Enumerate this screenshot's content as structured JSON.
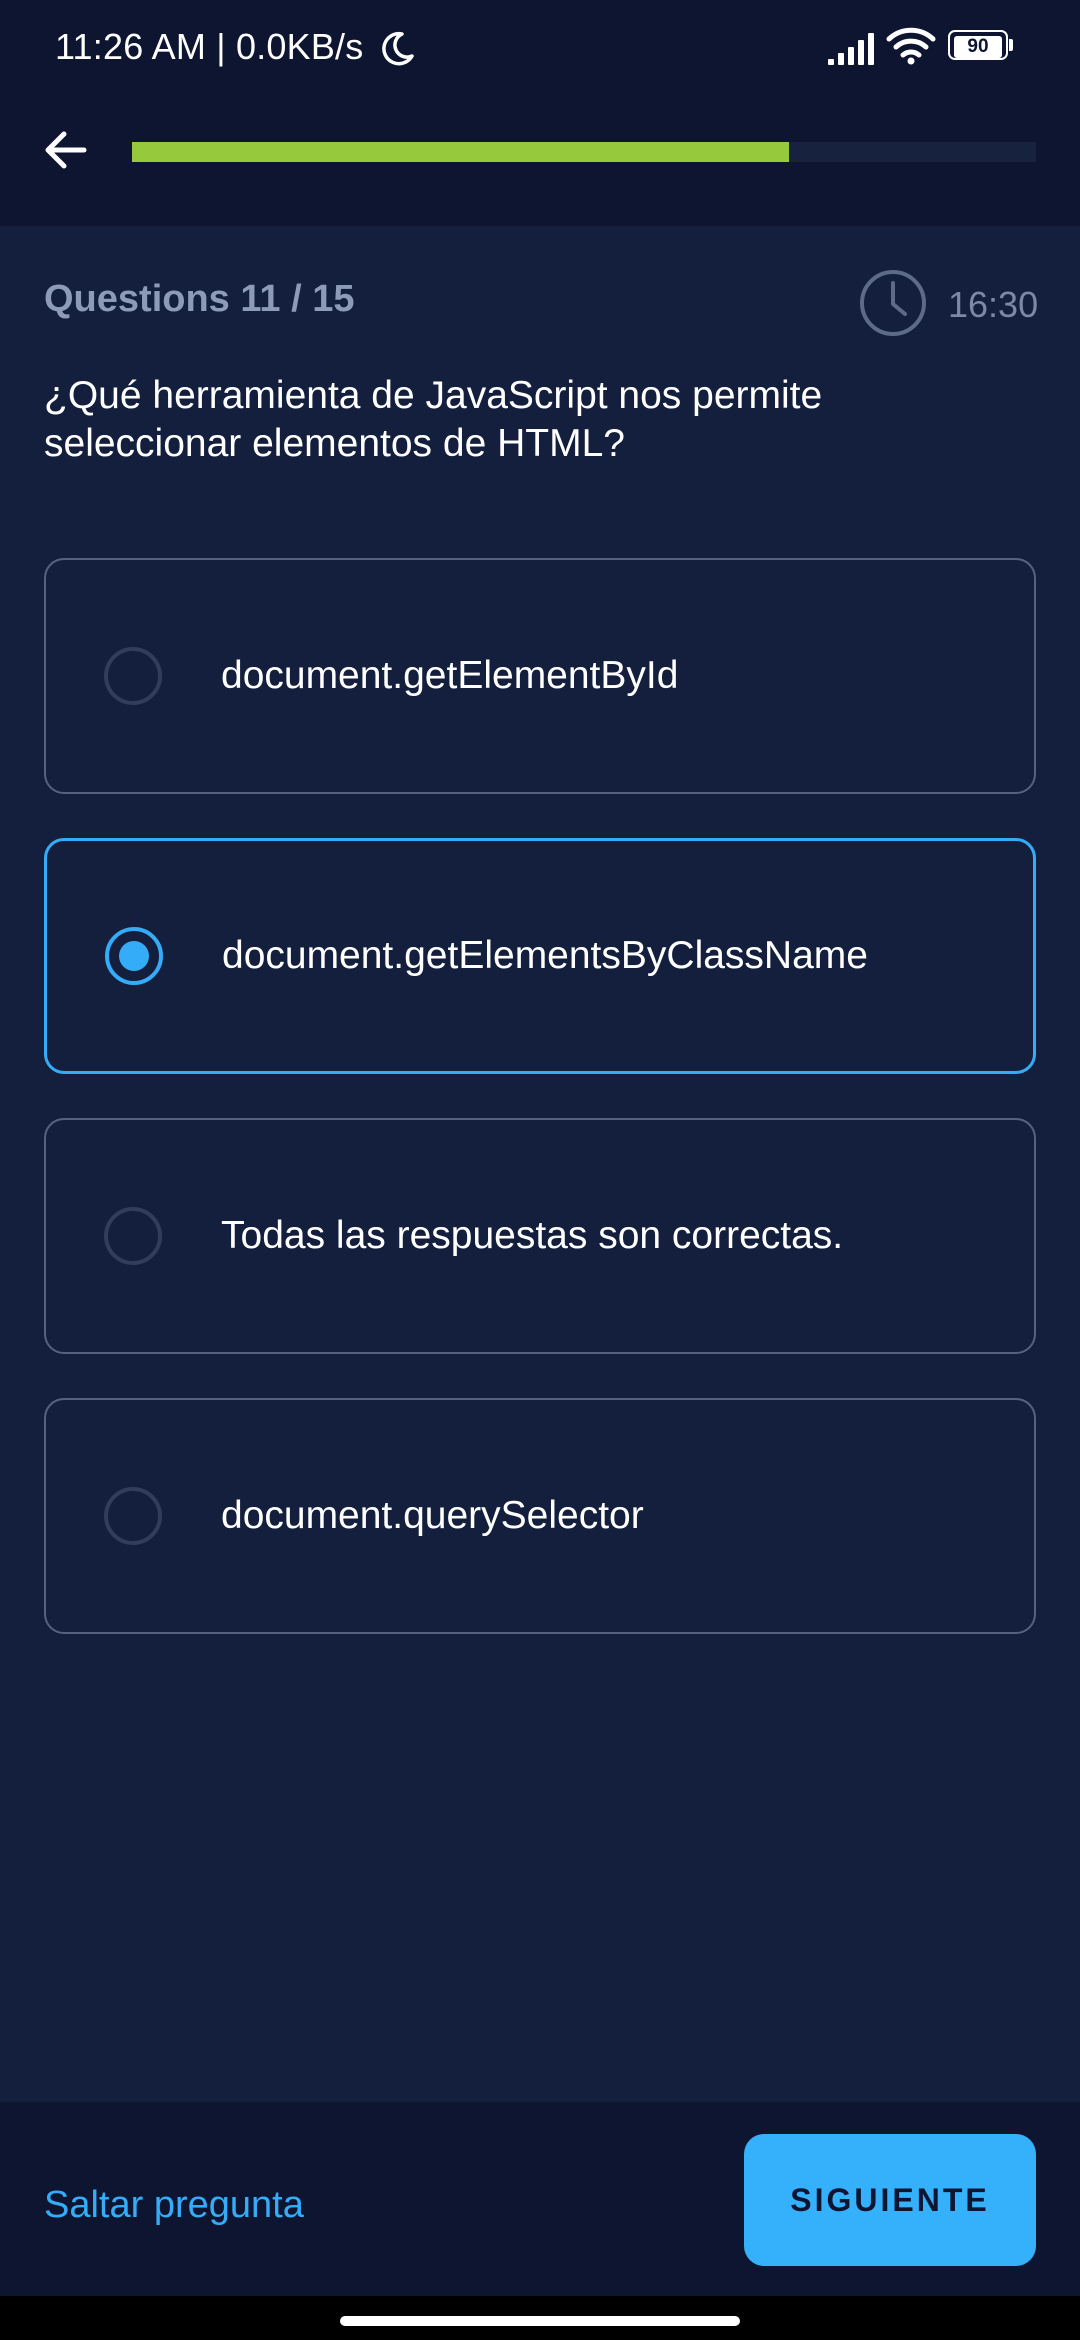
{
  "status_bar": {
    "time": "11:26 AM | 0.0KB/s",
    "battery": "90",
    "icons": [
      "moon-icon",
      "signal-icon",
      "wifi-icon",
      "battery-icon"
    ]
  },
  "header": {
    "back_icon": "arrow-left-icon",
    "progress_fraction": 0.727,
    "progress_color": "#97c93c",
    "track_color": "#17223f"
  },
  "quiz": {
    "question_count": "Questions 11 / 15",
    "timer_icon": "clock-icon",
    "timer": "16:30",
    "question": "¿Qué herramienta de JavaScript nos permite seleccionar elementos de HTML?",
    "options": [
      {
        "label": "document.getElementById",
        "selected": false
      },
      {
        "label": "document.getElementsByClassName",
        "selected": true
      },
      {
        "label": "Todas las respuestas son correctas.",
        "selected": false
      },
      {
        "label": "document.querySelector",
        "selected": false
      }
    ]
  },
  "footer": {
    "skip_label": "Saltar pregunta",
    "next_label": "SIGUIENTE"
  },
  "colors": {
    "background": "#131f3c",
    "bar_background": "#0d1531",
    "accent": "#35acf8",
    "option_border": "#56627e",
    "muted_text": "#8d9ab8"
  }
}
